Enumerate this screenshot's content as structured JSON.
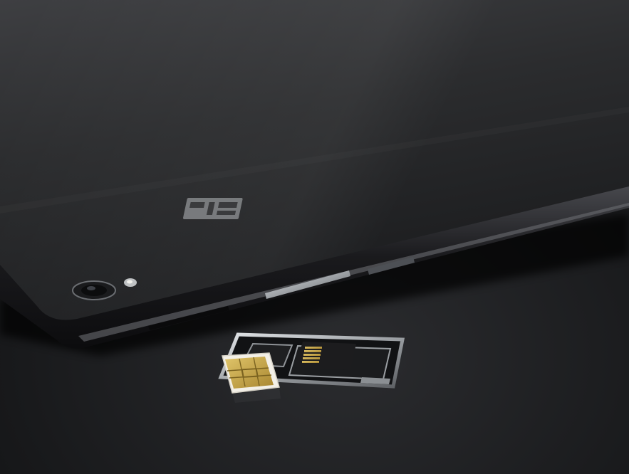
{
  "scene": {
    "subject": "smartphone-back-with-sim-tray",
    "colors": {
      "surface": "#1a1b1d",
      "phone_body": "#2a2b2d",
      "phone_frame": "#121214",
      "metal": "#b9bdc1",
      "sim_card": "#f2efe6",
      "sim_chip": "#c9a74a",
      "sd_contacts": "#c8a43e",
      "logo": "#8a8c8f"
    },
    "icons": [
      "camera-lens-icon",
      "flash-icon",
      "brand-logo-icon"
    ]
  }
}
